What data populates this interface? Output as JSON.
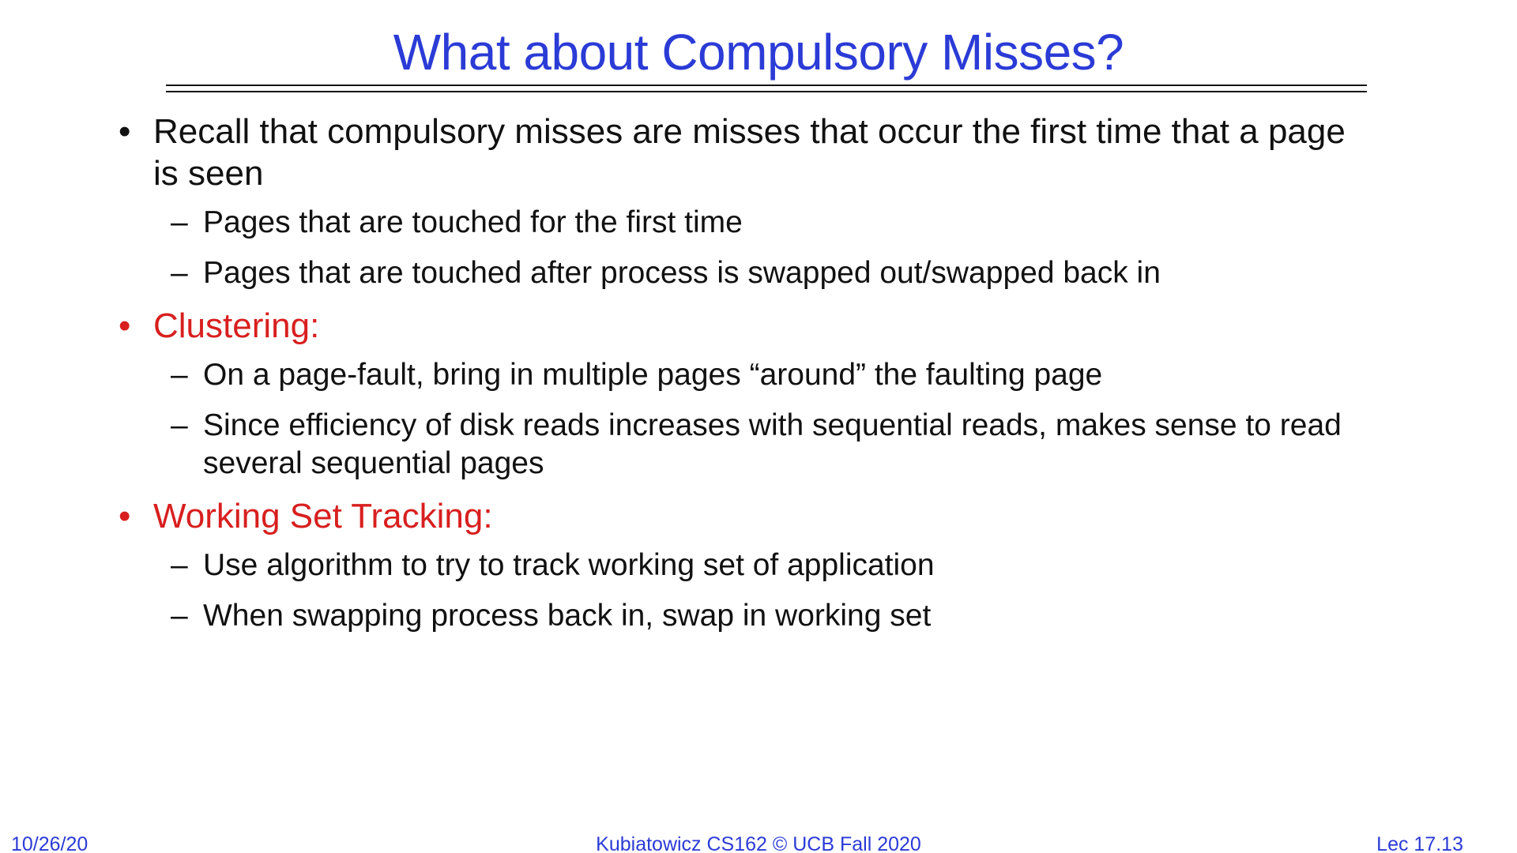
{
  "slide": {
    "title": "What about Compulsory Misses?",
    "bullet_glyph": "•",
    "dash_glyph": "–",
    "bullets": [
      {
        "text": "Recall that compulsory misses are misses that occur the first time that a page is seen",
        "color": "#111111",
        "subs": [
          "Pages that are touched for the first time",
          "Pages that are touched after process is swapped out/swapped back in"
        ]
      },
      {
        "text": "Clustering:",
        "color": "#d81f1f",
        "subs": [
          "On a page-fault, bring in multiple pages “around” the faulting page",
          "Since efficiency of disk reads increases with sequential reads, makes sense to read several sequential pages"
        ]
      },
      {
        "text": "Working Set Tracking:",
        "color": "#d81f1f",
        "subs": [
          "Use algorithm to try to track working set of application",
          "When swapping process back in, swap in working set"
        ]
      }
    ]
  },
  "footer": {
    "date": "10/26/20",
    "credit": "Kubiatowicz CS162 © UCB Fall 2020",
    "lecture": "Lec 17.13"
  },
  "colors": {
    "title": "#2b3bd6",
    "accent_red": "#d81f1f",
    "text": "#111111",
    "background": "#ffffff"
  }
}
